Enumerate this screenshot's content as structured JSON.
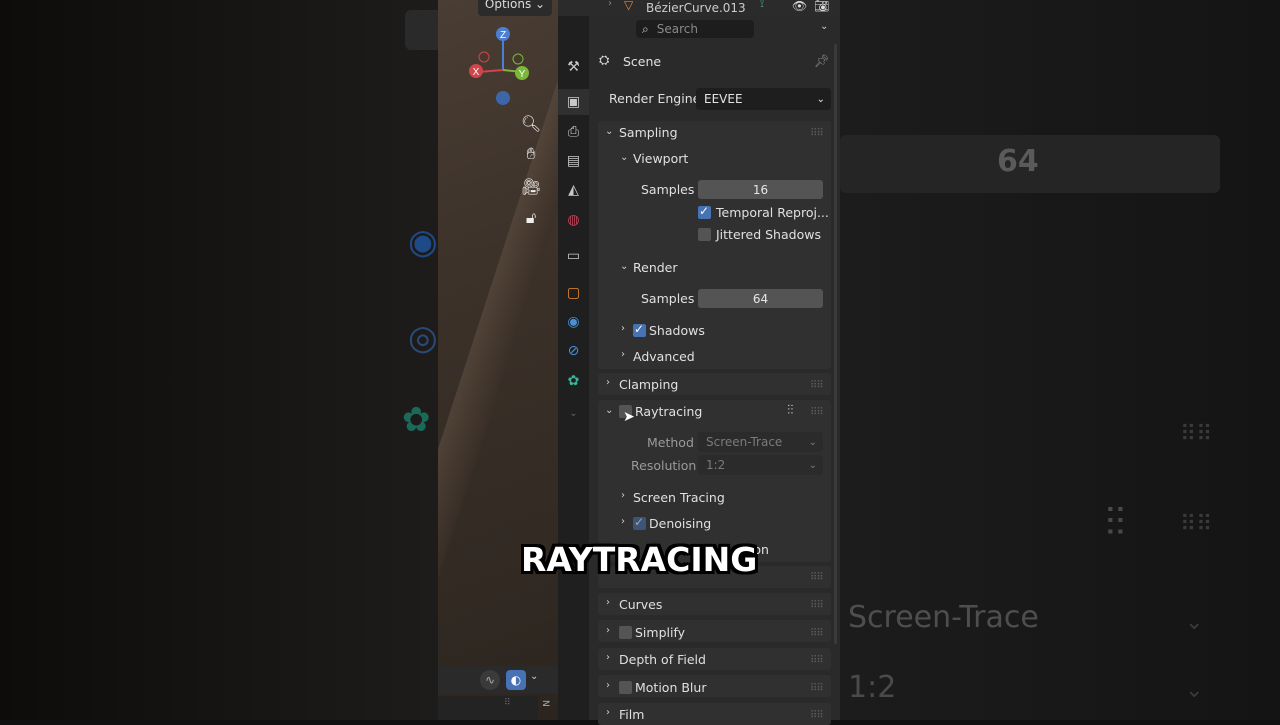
{
  "viewport": {
    "options_label": "Options",
    "object_name": "BézierCurve.013",
    "gizmo": {
      "z": "Z",
      "x": "X",
      "y": "Y"
    }
  },
  "header": {
    "search_placeholder": "Search"
  },
  "context": {
    "name": "Scene"
  },
  "render_engine": {
    "label": "Render Engine",
    "value": "EEVEE"
  },
  "sampling": {
    "title": "Sampling",
    "viewport": {
      "title": "Viewport",
      "samples_label": "Samples",
      "samples": "16",
      "temporal_reprojection": "Temporal Reproj...",
      "jittered_shadows": "Jittered Shadows"
    },
    "render": {
      "title": "Render",
      "samples_label": "Samples",
      "samples": "64"
    },
    "shadows": "Shadows",
    "advanced": "Advanced"
  },
  "clamping": "Clamping",
  "raytracing": {
    "title": "Raytracing",
    "method_label": "Method",
    "method_value": "Screen-Trace",
    "resolution_label": "Resolution",
    "resolution_value": "1:2",
    "screen_tracing": "Screen Tracing",
    "denoising": "Denoising",
    "partial_hidden": "tion"
  },
  "collapsed_panels": {
    "curves": "Curves",
    "simplify": "Simplify",
    "depth_of_field": "Depth of Field",
    "motion_blur": "Motion Blur",
    "film": "Film"
  },
  "background_zoom": {
    "samples_value": "64",
    "method_value": "Screen-Trace",
    "resolution_value": "1:2"
  },
  "caption": "RAYTRACING",
  "colors": {
    "panel": "#303030",
    "editor": "#2a2a2a",
    "checkbox_on": "#4772b3",
    "field": "#545454"
  }
}
